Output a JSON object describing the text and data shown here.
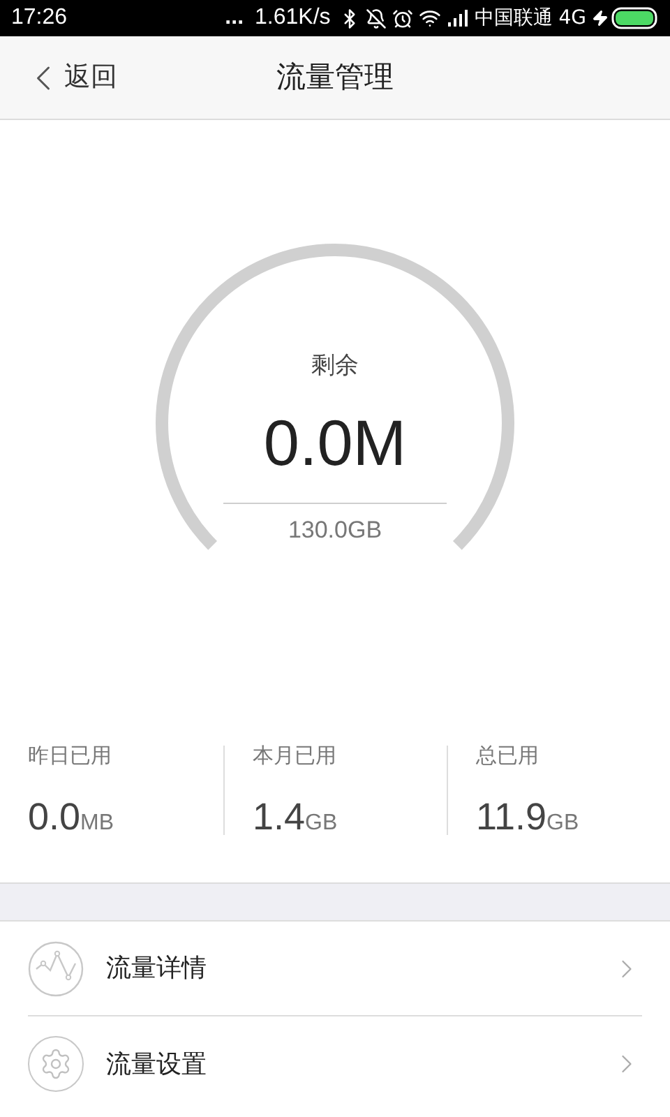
{
  "status_bar": {
    "time": "17:26",
    "dots": "...",
    "speed": "1.61K/s",
    "carrier": "中国联通 4G"
  },
  "header": {
    "back": "返回",
    "title": "流量管理"
  },
  "gauge": {
    "label": "剩余",
    "value": "0.0M",
    "total": "130.0GB"
  },
  "stats": [
    {
      "label": "昨日已用",
      "value": "0.0",
      "unit": "MB"
    },
    {
      "label": "本月已用",
      "value": "1.4",
      "unit": "GB"
    },
    {
      "label": "总已用",
      "value": "11.9",
      "unit": "GB"
    }
  ],
  "menu": [
    {
      "kind": "details",
      "label": "流量详情"
    },
    {
      "kind": "settings",
      "label": "流量设置"
    }
  ]
}
